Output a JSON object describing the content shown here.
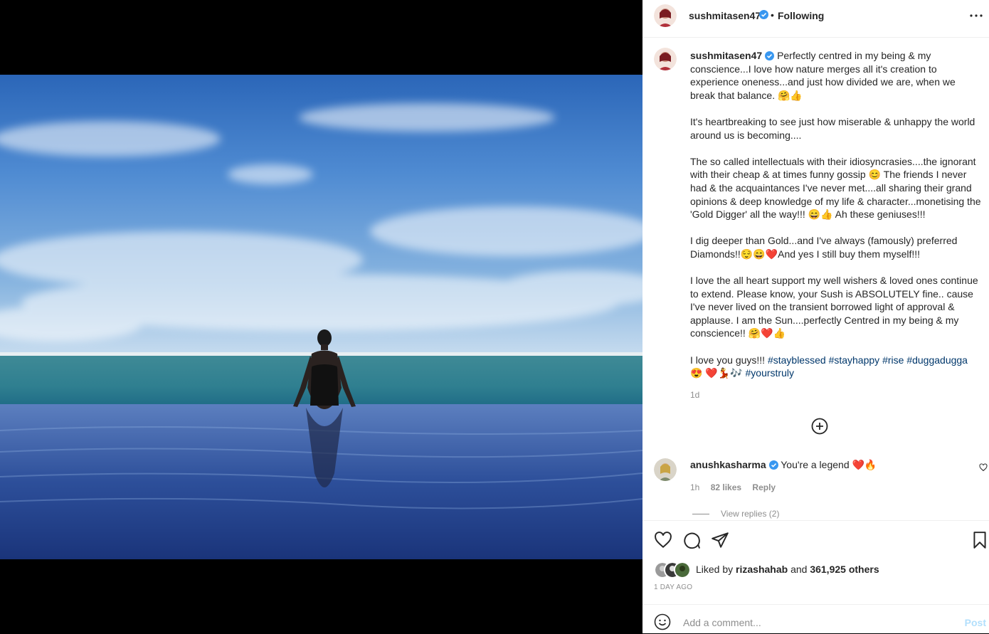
{
  "post": {
    "username": "sushmitasen47",
    "follow_status": "Following",
    "separator": "•",
    "timestamp": "1d",
    "likes_text_prefix": "Liked by",
    "liked_by": "rizashahab",
    "likes_and": "and",
    "likes_count": "361,925 others",
    "date_label": "1 DAY AGO",
    "add_comment_placeholder": "Add a comment...",
    "post_label": "Post"
  },
  "caption": {
    "paragraphs": [
      "Perfectly centred in my being & my conscience...I love how nature merges all it's creation to experience oneness...and just how divided we are, when we break that balance. 🤗👍",
      "It's heartbreaking to see just how miserable & unhappy the world around us is becoming....",
      "The so called intellectuals with their idiosyncrasies....the ignorant with their cheap & at times funny gossip 😊 The friends I never had & the acquaintances I've never met....all sharing their grand opinions & deep knowledge of my life & character...monetising the 'Gold Digger' all the way!!! 😄👍 Ah these geniuses!!!",
      "I dig deeper than Gold...and I've always (famously) preferred Diamonds!!😌😄❤️And yes I still buy them myself!!!",
      "I love the all heart support my well wishers & loved ones continue to extend. Please know, your Sush is ABSOLUTELY fine.. cause I've never lived on the transient borrowed light of approval & applause. I am the Sun....perfectly Centred in my being & my conscience!! 🤗❤️👍"
    ],
    "last_prefix": "I love you guys!!! ",
    "hashtags": [
      "#stayblessed",
      "#stayhappy",
      "#rise",
      "#duggadugga"
    ],
    "last_emoji_1": " 😍",
    "last_emoji_2": "❤️💃🎶 ",
    "last_tag": "#yourstruly"
  },
  "comment": {
    "username": "anushkasharma",
    "text": "You're a legend ❤️🔥",
    "time": "1h",
    "likes": "82 likes",
    "reply": "Reply",
    "view_replies": "View replies (2)"
  },
  "colors": {
    "link": "#00376b",
    "muted": "#8e8e8e",
    "verified": "#3897f0",
    "post_disabled": "#b2dffc"
  }
}
